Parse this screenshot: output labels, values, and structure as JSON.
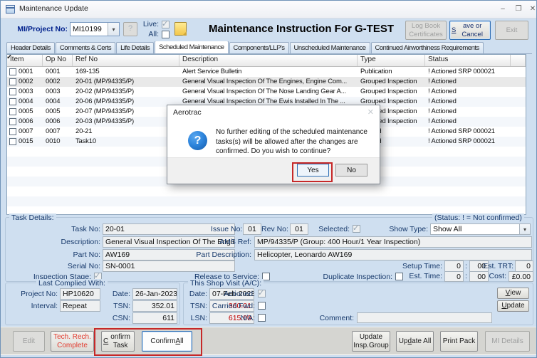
{
  "window": {
    "title": "Maintenance Update"
  },
  "icons": {
    "minimize": "–",
    "restore": "❐",
    "close": "✕",
    "combo_arrow": "▾",
    "question": "?"
  },
  "colors": {
    "panel_blue": "#cfdff0",
    "annotation_red": "#c62828",
    "value_red": "#c00000",
    "accent_red_text": "#e23b2e",
    "label_navy": "#17396b",
    "focus_blue": "#2f6fb5"
  },
  "header": {
    "project_label": "MI/Project No:",
    "project_value": "MI10199",
    "help_label": "?",
    "live_label": "Live:",
    "all_label": "All:",
    "live_checked": true,
    "all_checked": false,
    "title": "Maintenance Instruction For G-TEST",
    "logbook_label": "Log Book Certificates",
    "save_label": "Save or Cancel",
    "save_u": 0,
    "exit_label": "Exit"
  },
  "tabs": {
    "items": [
      {
        "label": "Header Details",
        "active": false
      },
      {
        "label": "Comments & Certs",
        "active": false
      },
      {
        "label": "Life Details",
        "active": false
      },
      {
        "label": "Scheduled Maintenance",
        "active": true
      },
      {
        "label": "Components/LLP's",
        "active": false
      },
      {
        "label": "Unscheduled Maintenance",
        "active": false
      },
      {
        "label": "Continued Airworthiness Requirements",
        "active": false
      }
    ]
  },
  "table": {
    "columns": [
      "Item",
      "Op No",
      "Ref No",
      "Description",
      "Type",
      "Status"
    ],
    "selected_index": 1,
    "rows": [
      {
        "checked": true,
        "item": "0001",
        "op": "0001",
        "ref": "169-135",
        "description": "Alert Service Bulletin",
        "type": "Publication",
        "status": "! Actioned SRP 000021"
      },
      {
        "checked": true,
        "item": "0002",
        "op": "0002",
        "ref": "20-01 (MP/94335/P)",
        "description": "General Visual Inspection Of The Engines, Engine Com...",
        "type": "Grouped Inspection",
        "status": "! Actioned"
      },
      {
        "checked": true,
        "item": "0003",
        "op": "0003",
        "ref": "20-02 (MP/94335/P)",
        "description": "General Visual Inspection Of The Nose Landing Gear A...",
        "type": "Grouped Inspection",
        "status": "! Actioned"
      },
      {
        "checked": true,
        "item": "0004",
        "op": "0004",
        "ref": "20-06 (MP/94335/P)",
        "description": "General Visual Inspection Of The Ewis Installed In The ...",
        "type": "Grouped Inspection",
        "status": "! Actioned"
      },
      {
        "checked": true,
        "item": "0005",
        "op": "0005",
        "ref": "20-07 (MP/94335/P)",
        "description": "General Visual Inspection Of The ...",
        "type": "Grouped Inspection",
        "status": "! Actioned"
      },
      {
        "checked": true,
        "item": "0006",
        "op": "0006",
        "ref": "20-03 (MP/94335/P)",
        "description": "",
        "type": "Grouped Inspection",
        "status": "! Actioned"
      },
      {
        "checked": true,
        "item": "0007",
        "op": "0007",
        "ref": "20-21",
        "description": "",
        "type": "Record",
        "status": "! Actioned SRP 000021"
      },
      {
        "checked": true,
        "item": "0015",
        "op": "0010",
        "ref": "Task10",
        "description": "",
        "type": "Record",
        "status": "! Actioned SRP 000021"
      }
    ]
  },
  "dialog": {
    "title": "Aerotrac",
    "message": "No further editing of the scheduled maintenance tasks(s) will be allowed after the changes are confirmed. Do you wish to continue?",
    "yes_label": "Yes",
    "no_label": "No"
  },
  "task_details": {
    "section_label": "Task Details:",
    "status_note": "(Status: ! = Not confirmed)",
    "task_no_label": "Task No:",
    "task_no": "20-01",
    "issue_no_label": "Issue No:",
    "issue_no": "01",
    "rev_no_label": "Rev No:",
    "rev_no": "01",
    "selected_label": "Selected:",
    "selected_checked": true,
    "show_type_label": "Show Type:",
    "show_type": "Show All",
    "description_label": "Description:",
    "description": "General Visual Inspection Of The Engines, Engin",
    "ams_ref_label": "AMS Ref:",
    "ams_ref": "MP/94335/P (Group: 400 Hour/1 Year Inspection)",
    "part_no_label": "Part No:",
    "part_no": "AW169",
    "part_desc_label": "Part Description:",
    "part_desc": "Helicopter, Leonardo AW169",
    "serial_no_label": "Serial No:",
    "serial_no": "SN-0001",
    "inspection_stage_label": "Inspection Stage:",
    "inspection_stage_checked": true,
    "release_label": "Release to Service:",
    "release_checked": false,
    "duplicate_label": "Duplicate Inspection:",
    "duplicate_checked": false,
    "setup_time_label": "Setup Time:",
    "setup_h": "0",
    "setup_m": "00",
    "est_trt_label": "Est. TRT:",
    "est_trt": "0",
    "est_time_label": "Est. Time:",
    "est_h": "0",
    "est_m": "00",
    "cost_label": "Cost:",
    "cost": "£0.00",
    "time_colon": ":"
  },
  "last_complied": {
    "section_label": "Last Complied With:",
    "project_label": "Project No:",
    "project": "HP10620",
    "date_label": "Date:",
    "date": "26-Jan-2023",
    "interval_label": "Interval:",
    "interval": "Repeat",
    "tsn_label": "TSN:",
    "tsn": "352.01",
    "csn_label": "CSN:",
    "csn": "611"
  },
  "shop_visit": {
    "section_label": "This Shop Visit (A/C):",
    "date_label": "Date:",
    "date": "07-Feb-2023",
    "actioned_label": "Actioned:",
    "actioned_checked": true,
    "tsn_label": "TSN:",
    "tsn": "360.01",
    "carried_label": "Carried Fwd:",
    "carried_checked": false,
    "lsn_label": "LSN:",
    "lsn": "615.00",
    "na_label": "N/A:",
    "na_checked": false,
    "comment_label": "Comment:",
    "comment": "",
    "view_label": "View",
    "view_u": 0,
    "update_label": "Update",
    "update_u": 0
  },
  "footer": {
    "buttons": [
      {
        "label": "Edit",
        "u": -1,
        "disabled": true
      },
      {
        "label": "Tech. Rech. Complete",
        "u": -1,
        "red": true
      },
      {
        "label": "Confirm Task",
        "u": 0
      },
      {
        "label": "Confirm All",
        "u": 8,
        "focused": true
      },
      {
        "label": "Update Insp.Group",
        "u": -1
      },
      {
        "label": "Update All",
        "u": 2
      },
      {
        "label": "Print Pack",
        "u": -1
      },
      {
        "label": "MI Details",
        "u": -1,
        "disabled": true
      }
    ]
  }
}
